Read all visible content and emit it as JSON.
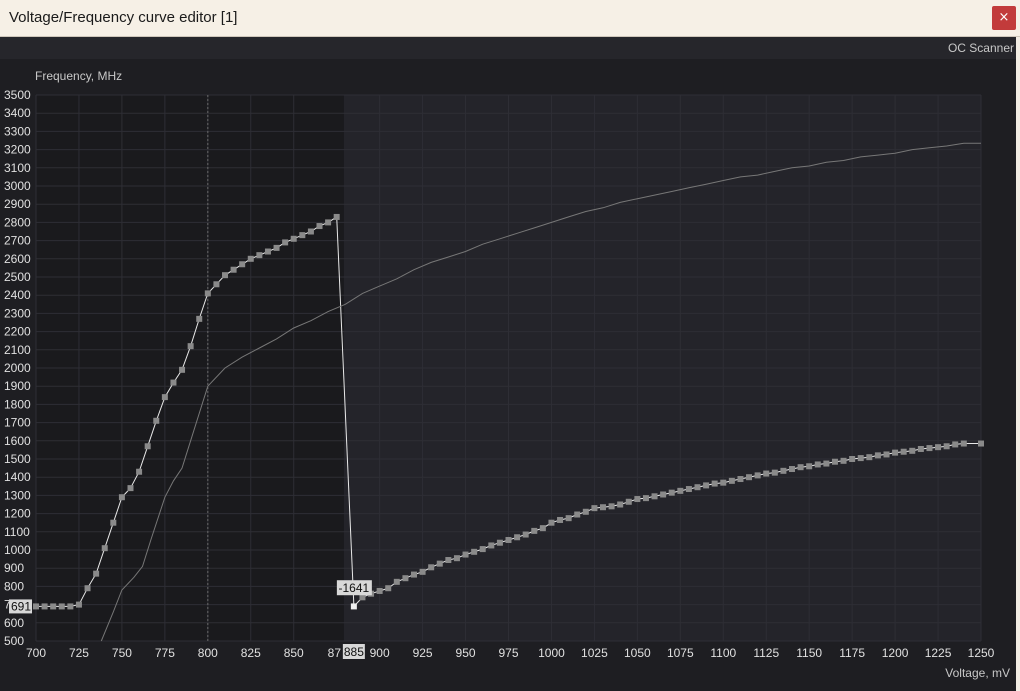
{
  "window": {
    "title": "Voltage/Frequency curve editor [1]",
    "close_glyph": "×",
    "close_icon": "close-icon"
  },
  "toolbar": {
    "oc_scanner_label": "OC Scanner"
  },
  "colors": {
    "titlebar_bg": "#f6f0e6",
    "close_bg": "#c23b3b",
    "plot_bg": "#222228",
    "curve_active": "#e8e8e8",
    "curve_inactive": "#777777",
    "point": "#8a8a8a"
  },
  "chart_data": {
    "type": "line",
    "title": "",
    "xlabel": "Voltage, mV",
    "ylabel": "Frequency, MHz",
    "xlim": [
      700,
      1250
    ],
    "ylim": [
      500,
      3500
    ],
    "x_ticks": [
      "700",
      "725",
      "750",
      "775",
      "800",
      "825",
      "850",
      "87",
      "885",
      "900",
      "925",
      "950",
      "975",
      "1000",
      "1025",
      "1050",
      "1075",
      "1100",
      "1125",
      "1150",
      "1175",
      "1200",
      "1225",
      "1250"
    ],
    "y_ticks": [
      "3500",
      "3400",
      "3300",
      "3200",
      "3100",
      "3000",
      "2900",
      "2800",
      "2700",
      "2600",
      "2500",
      "2400",
      "2300",
      "2200",
      "2100",
      "2000",
      "1900",
      "1800",
      "1700",
      "1600",
      "1500",
      "1400",
      "1300",
      "1200",
      "1100",
      "1000",
      "900",
      "800",
      "700",
      "600",
      "500"
    ],
    "grid": true,
    "reference_voltage": 800,
    "highlight_voltage": 885,
    "y_marker_label": "691",
    "offset_label": "-1641",
    "x_marker_label": "885",
    "series": [
      {
        "values": [
          [
            700,
            690
          ],
          [
            705,
            690
          ],
          [
            710,
            690
          ],
          [
            715,
            690
          ],
          [
            720,
            690
          ],
          [
            725,
            700
          ],
          [
            730,
            790
          ],
          [
            735,
            870
          ],
          [
            740,
            1010
          ],
          [
            745,
            1150
          ],
          [
            750,
            1290
          ],
          [
            755,
            1340
          ],
          [
            760,
            1430
          ],
          [
            765,
            1570
          ],
          [
            770,
            1710
          ],
          [
            775,
            1840
          ],
          [
            780,
            1920
          ],
          [
            785,
            1990
          ],
          [
            790,
            2120
          ],
          [
            795,
            2270
          ],
          [
            800,
            2410
          ],
          [
            805,
            2460
          ],
          [
            810,
            2510
          ],
          [
            815,
            2540
          ],
          [
            820,
            2570
          ],
          [
            825,
            2600
          ],
          [
            830,
            2620
          ],
          [
            835,
            2640
          ],
          [
            840,
            2660
          ],
          [
            845,
            2690
          ],
          [
            850,
            2710
          ],
          [
            855,
            2730
          ],
          [
            860,
            2750
          ],
          [
            865,
            2780
          ],
          [
            870,
            2800
          ],
          [
            875,
            2830
          ],
          [
            885,
            690
          ]
        ]
      },
      {
        "values": [
          [
            885,
            690
          ],
          [
            890,
            740
          ],
          [
            895,
            760
          ],
          [
            900,
            775
          ],
          [
            905,
            790
          ],
          [
            910,
            825
          ],
          [
            915,
            845
          ],
          [
            920,
            865
          ],
          [
            925,
            880
          ],
          [
            930,
            905
          ],
          [
            935,
            925
          ],
          [
            940,
            945
          ],
          [
            945,
            955
          ],
          [
            950,
            975
          ],
          [
            955,
            990
          ],
          [
            960,
            1005
          ],
          [
            965,
            1025
          ],
          [
            970,
            1040
          ],
          [
            975,
            1055
          ],
          [
            980,
            1070
          ],
          [
            985,
            1085
          ],
          [
            990,
            1105
          ],
          [
            995,
            1120
          ],
          [
            1000,
            1150
          ],
          [
            1005,
            1165
          ],
          [
            1010,
            1175
          ],
          [
            1015,
            1195
          ],
          [
            1020,
            1210
          ],
          [
            1025,
            1230
          ],
          [
            1030,
            1235
          ],
          [
            1035,
            1240
          ],
          [
            1040,
            1250
          ],
          [
            1045,
            1265
          ],
          [
            1050,
            1280
          ],
          [
            1055,
            1285
          ],
          [
            1060,
            1295
          ],
          [
            1065,
            1305
          ],
          [
            1070,
            1315
          ],
          [
            1075,
            1325
          ],
          [
            1080,
            1335
          ],
          [
            1085,
            1345
          ],
          [
            1090,
            1355
          ],
          [
            1095,
            1365
          ],
          [
            1100,
            1370
          ],
          [
            1105,
            1380
          ],
          [
            1110,
            1390
          ],
          [
            1115,
            1400
          ],
          [
            1120,
            1410
          ],
          [
            1125,
            1420
          ],
          [
            1130,
            1425
          ],
          [
            1135,
            1435
          ],
          [
            1140,
            1445
          ],
          [
            1145,
            1455
          ],
          [
            1150,
            1460
          ],
          [
            1155,
            1470
          ],
          [
            1160,
            1475
          ],
          [
            1165,
            1485
          ],
          [
            1170,
            1490
          ],
          [
            1175,
            1500
          ],
          [
            1180,
            1505
          ],
          [
            1185,
            1510
          ],
          [
            1190,
            1520
          ],
          [
            1195,
            1525
          ],
          [
            1200,
            1535
          ],
          [
            1205,
            1540
          ],
          [
            1210,
            1545
          ],
          [
            1215,
            1555
          ],
          [
            1220,
            1560
          ],
          [
            1225,
            1565
          ],
          [
            1230,
            1570
          ],
          [
            1235,
            1580
          ],
          [
            1240,
            1585
          ],
          [
            1250,
            1585
          ]
        ]
      },
      {
        "values": [
          [
            738,
            500
          ],
          [
            745,
            660
          ],
          [
            750,
            780
          ],
          [
            757,
            850
          ],
          [
            762,
            910
          ],
          [
            767,
            1060
          ],
          [
            775,
            1290
          ],
          [
            780,
            1380
          ],
          [
            785,
            1450
          ],
          [
            790,
            1600
          ],
          [
            795,
            1750
          ],
          [
            800,
            1900
          ],
          [
            810,
            2000
          ],
          [
            820,
            2060
          ],
          [
            830,
            2110
          ],
          [
            840,
            2160
          ],
          [
            850,
            2220
          ],
          [
            860,
            2260
          ],
          [
            870,
            2310
          ],
          [
            880,
            2350
          ],
          [
            890,
            2410
          ],
          [
            900,
            2450
          ],
          [
            910,
            2490
          ],
          [
            920,
            2540
          ],
          [
            930,
            2580
          ],
          [
            940,
            2610
          ],
          [
            950,
            2640
          ],
          [
            960,
            2680
          ],
          [
            970,
            2710
          ],
          [
            980,
            2740
          ],
          [
            990,
            2770
          ],
          [
            1000,
            2800
          ],
          [
            1010,
            2830
          ],
          [
            1020,
            2860
          ],
          [
            1030,
            2880
          ],
          [
            1040,
            2910
          ],
          [
            1050,
            2930
          ],
          [
            1060,
            2950
          ],
          [
            1070,
            2970
          ],
          [
            1080,
            2990
          ],
          [
            1090,
            3010
          ],
          [
            1100,
            3030
          ],
          [
            1110,
            3050
          ],
          [
            1120,
            3060
          ],
          [
            1130,
            3080
          ],
          [
            1140,
            3100
          ],
          [
            1150,
            3110
          ],
          [
            1160,
            3130
          ],
          [
            1170,
            3140
          ],
          [
            1180,
            3160
          ],
          [
            1190,
            3170
          ],
          [
            1200,
            3180
          ],
          [
            1210,
            3200
          ],
          [
            1220,
            3210
          ],
          [
            1230,
            3220
          ],
          [
            1240,
            3235
          ],
          [
            1250,
            3235
          ]
        ]
      }
    ]
  }
}
